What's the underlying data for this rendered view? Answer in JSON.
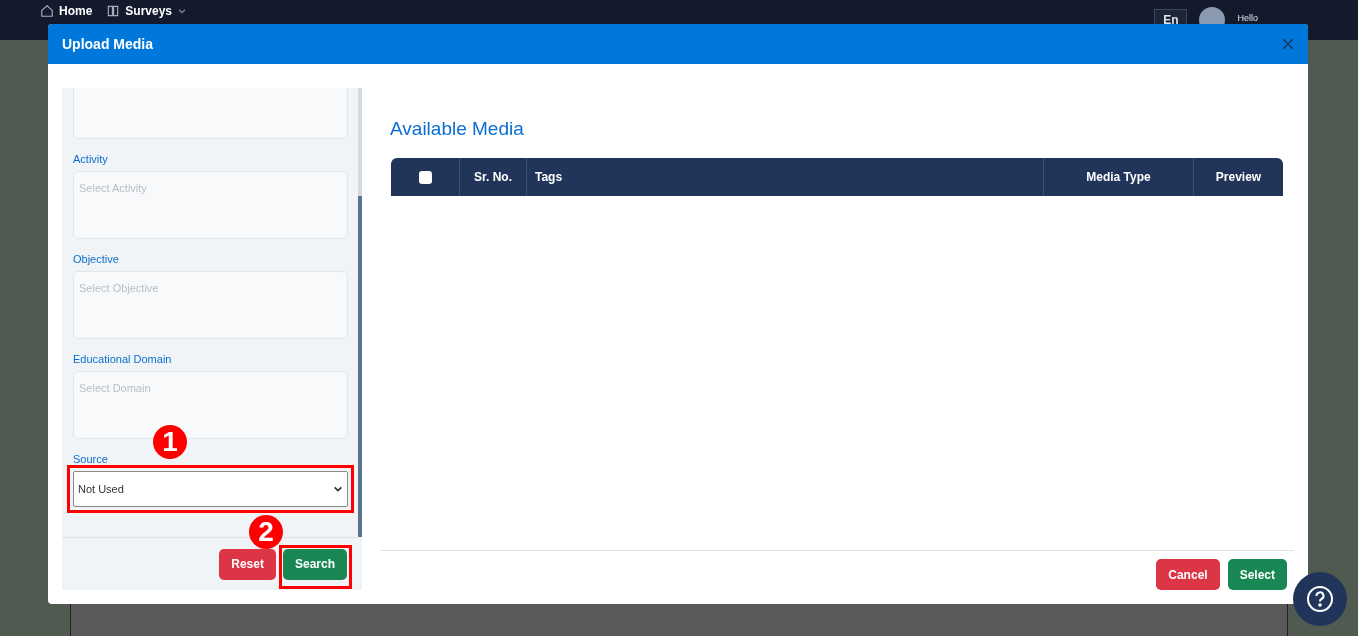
{
  "navbar": {
    "items": [
      {
        "label": "Home",
        "kind": "home"
      },
      {
        "label": "Surveys",
        "kind": "menu"
      }
    ],
    "language": "En",
    "greeting": "Hello"
  },
  "modal": {
    "title": "Upload Media"
  },
  "filters": [
    {
      "kind": "textarea"
    },
    {
      "kind": "textarea",
      "label": "Activity",
      "placeholder": "Select Activity"
    },
    {
      "kind": "textarea",
      "label": "Objective",
      "placeholder": "Select Objective"
    },
    {
      "kind": "textarea",
      "label": "Educational Domain",
      "placeholder": "Select Domain"
    },
    {
      "kind": "select",
      "label": "Source",
      "value": "Not Used",
      "callout": "1"
    }
  ],
  "filter_actions": [
    {
      "label": "Reset",
      "kind": "danger"
    },
    {
      "label": "Search",
      "kind": "success",
      "callout": "2"
    }
  ],
  "media": {
    "title": "Available Media",
    "columns": [
      {
        "kind": "checkbox",
        "checked": false
      },
      {
        "kind": "text",
        "label": "Sr. No."
      },
      {
        "kind": "wide",
        "label": "Tags"
      },
      {
        "kind": "text",
        "label": "Media Type"
      },
      {
        "kind": "text",
        "label": "Preview"
      }
    ]
  },
  "footer_actions": [
    {
      "label": "Cancel",
      "kind": "danger"
    },
    {
      "label": "Select",
      "kind": "success"
    }
  ]
}
